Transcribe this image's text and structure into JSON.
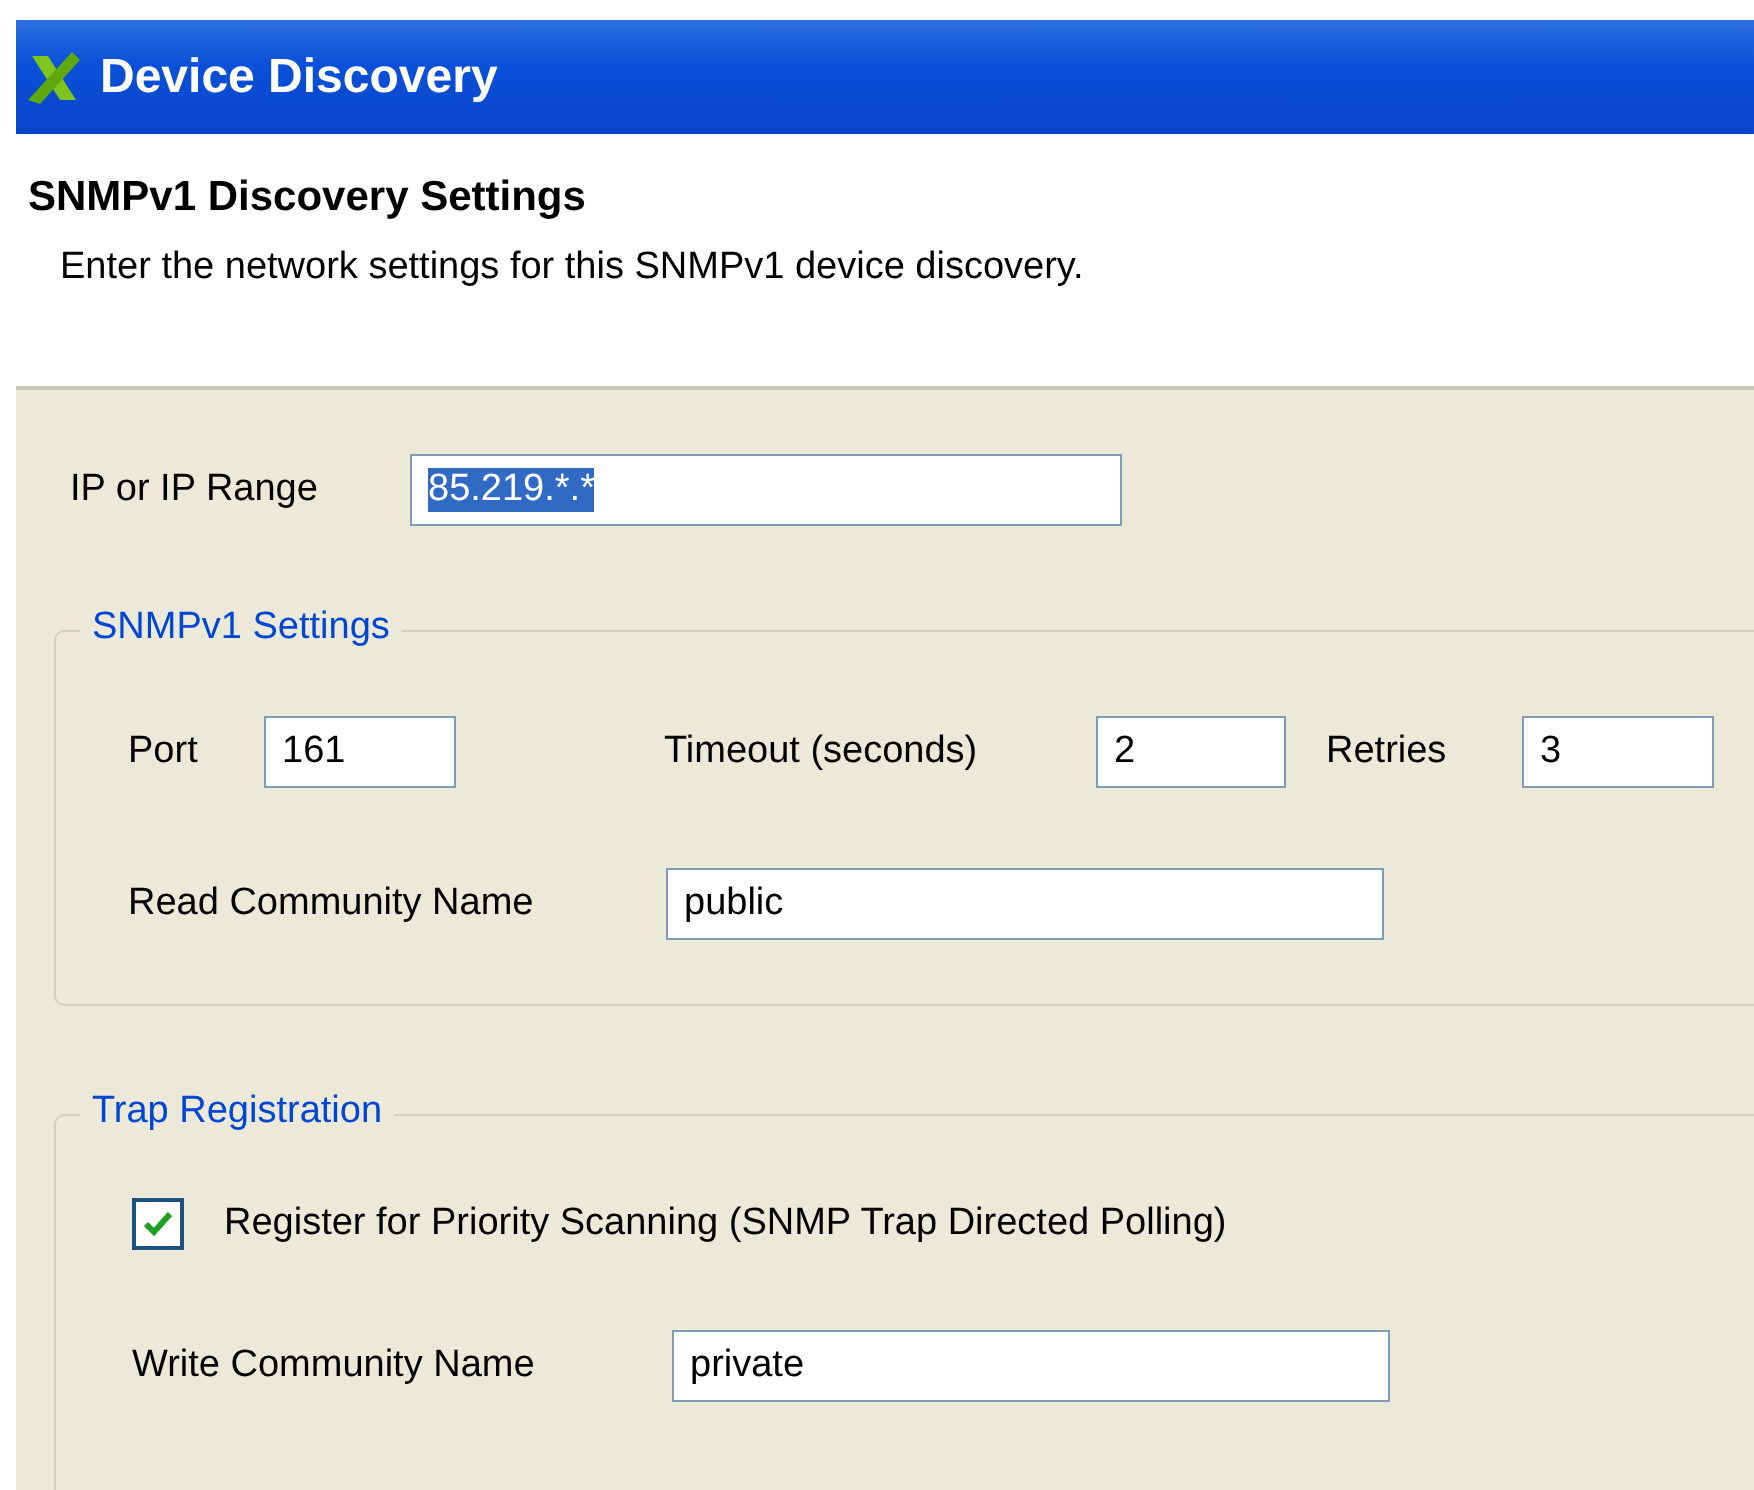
{
  "window": {
    "title": "Device Discovery"
  },
  "header": {
    "title": "SNMPv1 Discovery Settings",
    "description": "Enter the network settings for this SNMPv1 device discovery."
  },
  "ip_range": {
    "label": "IP or IP Range",
    "value": "85.219.*.*",
    "selected": true
  },
  "snmp_settings": {
    "legend": "SNMPv1 Settings",
    "port": {
      "label": "Port",
      "value": "161"
    },
    "timeout": {
      "label": "Timeout (seconds)",
      "value": "2"
    },
    "retries": {
      "label": "Retries",
      "value": "3"
    },
    "read_community": {
      "label": "Read Community Name",
      "value": "public"
    }
  },
  "trap_registration": {
    "legend": "Trap Registration",
    "priority_scanning": {
      "label": "Register for Priority Scanning (SNMP Trap Directed Polling)",
      "checked": true
    },
    "write_community": {
      "label": "Write Community Name",
      "value": "private"
    }
  }
}
